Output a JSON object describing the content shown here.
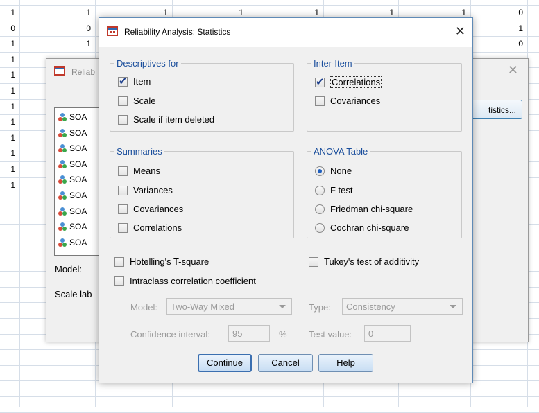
{
  "spreadsheet": {
    "rows": [
      {
        "c0": "1",
        "c1": "1",
        "c2": "1",
        "c3": "1",
        "c4": "1",
        "c5": "1",
        "c6": "1",
        "c7": "0"
      },
      {
        "c0": "0",
        "c1": "0",
        "c7": "1"
      },
      {
        "c0": "1",
        "c1": "1",
        "c7": "0"
      },
      {
        "c0": "1"
      },
      {
        "c0": "1"
      },
      {
        "c0": "1"
      },
      {
        "c0": "1"
      },
      {
        "c0": "1"
      },
      {
        "c0": "1"
      },
      {
        "c0": "1"
      },
      {
        "c0": "1"
      },
      {
        "c0": "1"
      }
    ]
  },
  "background_dialog": {
    "title": "Reliab",
    "variables": [
      "SOA",
      "SOA",
      "SOA",
      "SOA",
      "SOA",
      "SOA",
      "SOA",
      "SOA",
      "SOA"
    ],
    "model_label": "Model:",
    "scale_label": "Scale lab",
    "statistics_button": "tistics..."
  },
  "dialog": {
    "title": "Reliability Analysis: Statistics",
    "descriptives": {
      "legend": "Descriptives for",
      "item": {
        "label": "Item",
        "checked": true
      },
      "scale": {
        "label": "Scale",
        "checked": false
      },
      "scale_if_deleted": {
        "label": "Scale if item deleted",
        "checked": false
      }
    },
    "inter_item": {
      "legend": "Inter-Item",
      "correlations": {
        "label": "Correlations",
        "checked": true
      },
      "covariances": {
        "label": "Covariances",
        "checked": false
      }
    },
    "summaries": {
      "legend": "Summaries",
      "means": "Means",
      "variances": "Variances",
      "covariances": "Covariances",
      "correlations": "Correlations"
    },
    "anova": {
      "legend": "ANOVA Table",
      "none": "None",
      "f_test": "F test",
      "friedman": "Friedman chi-square",
      "cochran": "Cochran chi-square",
      "selected": "None"
    },
    "hotelling": "Hotelling's T-square",
    "tukey": "Tukey's test of additivity",
    "intraclass": "Intraclass correlation coefficient",
    "model": {
      "label": "Model:",
      "value": "Two-Way Mixed"
    },
    "type": {
      "label": "Type:",
      "value": "Consistency"
    },
    "confidence": {
      "label": "Confidence interval:",
      "value": "95",
      "unit": "%"
    },
    "test_value": {
      "label": "Test value:",
      "value": "0"
    },
    "buttons": {
      "continue": "Continue",
      "cancel": "Cancel",
      "help": "Help"
    }
  },
  "colors": {
    "legend": "#1a4e9c",
    "accent": "#3b6fb0"
  }
}
